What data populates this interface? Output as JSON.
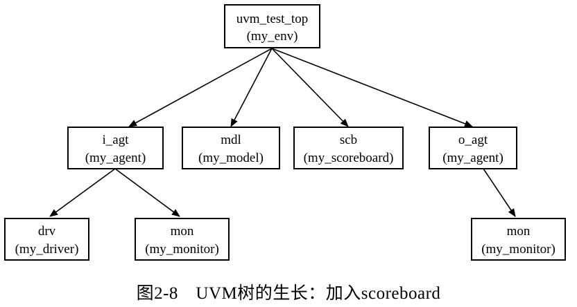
{
  "nodes": {
    "top": {
      "name": "uvm_test_top",
      "type": "(my_env)"
    },
    "i_agt": {
      "name": "i_agt",
      "type": "(my_agent)"
    },
    "mdl": {
      "name": "mdl",
      "type": "(my_model)"
    },
    "scb": {
      "name": "scb",
      "type": "(my_scoreboard)"
    },
    "o_agt": {
      "name": "o_agt",
      "type": "(my_agent)"
    },
    "drv": {
      "name": "drv",
      "type": "(my_driver)"
    },
    "i_mon": {
      "name": "mon",
      "type": "(my_monitor)"
    },
    "o_mon": {
      "name": "mon",
      "type": "(my_monitor)"
    }
  },
  "caption": "图2-8　UVM树的生长：加入scoreboard"
}
